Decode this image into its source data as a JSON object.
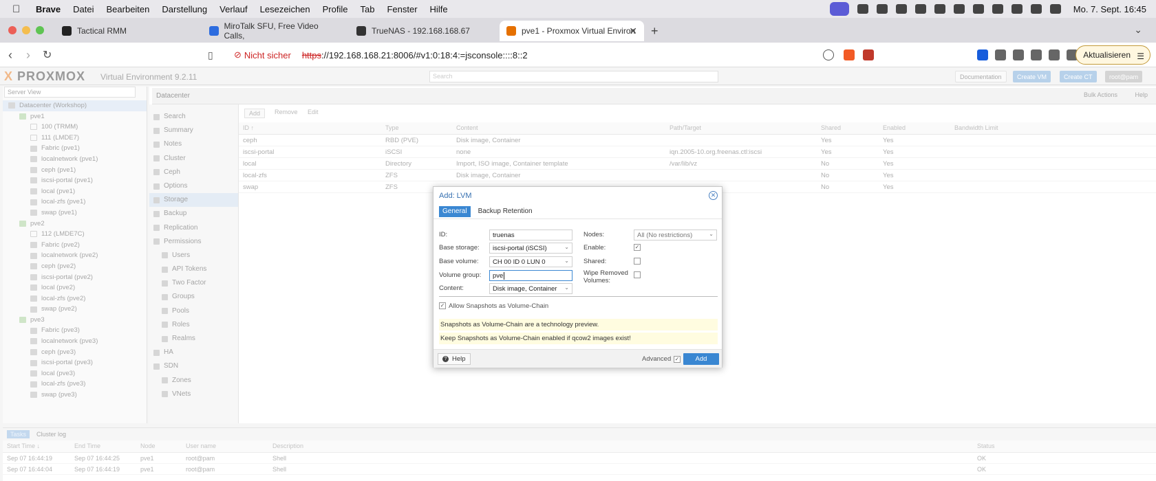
{
  "menubar": {
    "items": [
      "Brave",
      "Datei",
      "Bearbeiten",
      "Darstellung",
      "Verlauf",
      "Lesezeichen",
      "Profile",
      "Tab",
      "Fenster",
      "Hilfe"
    ],
    "clock": "Mo. 7. Sept.  16:45"
  },
  "tabs": [
    {
      "title": "Tactical RMM"
    },
    {
      "title": "MiroTalk SFU, Free Video Calls,"
    },
    {
      "title": "TrueNAS - 192.168.168.67"
    },
    {
      "title": "pve1 - Proxmox Virtual Environ"
    }
  ],
  "address": {
    "warning": "Nicht sicher",
    "scheme": "https",
    "rest": "://192.168.168.21:8006/#v1:0:18:4:=jsconsole::::8::2",
    "update_label": "Aktualisieren"
  },
  "pve": {
    "version": "Virtual Environment 9.2.11",
    "search_placeholder": "Search",
    "documentation": "Documentation",
    "create_vm": "Create VM",
    "create_ct": "Create CT",
    "user": "root@pam",
    "server_view": "Server View",
    "tree": [
      {
        "label": "Datacenter (Workshop)",
        "indent": 0,
        "kind": "dc"
      },
      {
        "label": "pve1",
        "indent": 1,
        "kind": "node"
      },
      {
        "label": "100 (TRMM)",
        "indent": 2,
        "kind": "vm"
      },
      {
        "label": "111 (LMDE7)",
        "indent": 2,
        "kind": "vm"
      },
      {
        "label": "Fabric (pve1)",
        "indent": 2,
        "kind": "x"
      },
      {
        "label": "localnetwork (pve1)",
        "indent": 2,
        "kind": "x"
      },
      {
        "label": "ceph (pve1)",
        "indent": 2,
        "kind": "x"
      },
      {
        "label": "iscsi-portal (pve1)",
        "indent": 2,
        "kind": "x"
      },
      {
        "label": "local (pve1)",
        "indent": 2,
        "kind": "x"
      },
      {
        "label": "local-zfs (pve1)",
        "indent": 2,
        "kind": "x"
      },
      {
        "label": "swap (pve1)",
        "indent": 2,
        "kind": "x"
      },
      {
        "label": "pve2",
        "indent": 1,
        "kind": "node"
      },
      {
        "label": "112 (LMDE7C)",
        "indent": 2,
        "kind": "vm"
      },
      {
        "label": "Fabric (pve2)",
        "indent": 2,
        "kind": "x"
      },
      {
        "label": "localnetwork (pve2)",
        "indent": 2,
        "kind": "x"
      },
      {
        "label": "ceph (pve2)",
        "indent": 2,
        "kind": "x"
      },
      {
        "label": "iscsi-portal (pve2)",
        "indent": 2,
        "kind": "x"
      },
      {
        "label": "local (pve2)",
        "indent": 2,
        "kind": "x"
      },
      {
        "label": "local-zfs (pve2)",
        "indent": 2,
        "kind": "x"
      },
      {
        "label": "swap (pve2)",
        "indent": 2,
        "kind": "x"
      },
      {
        "label": "pve3",
        "indent": 1,
        "kind": "node"
      },
      {
        "label": "Fabric (pve3)",
        "indent": 2,
        "kind": "x"
      },
      {
        "label": "localnetwork (pve3)",
        "indent": 2,
        "kind": "x"
      },
      {
        "label": "ceph (pve3)",
        "indent": 2,
        "kind": "x"
      },
      {
        "label": "iscsi-portal (pve3)",
        "indent": 2,
        "kind": "x"
      },
      {
        "label": "local (pve3)",
        "indent": 2,
        "kind": "x"
      },
      {
        "label": "local-zfs (pve3)",
        "indent": 2,
        "kind": "x"
      },
      {
        "label": "swap (pve3)",
        "indent": 2,
        "kind": "x"
      }
    ],
    "breadcrumb": "Datacenter",
    "bulk_actions": "Bulk Actions",
    "help": "Help",
    "menu": [
      {
        "label": "Search",
        "sub": false
      },
      {
        "label": "Summary",
        "sub": false
      },
      {
        "label": "Notes",
        "sub": false
      },
      {
        "label": "Cluster",
        "sub": false
      },
      {
        "label": "Ceph",
        "sub": false
      },
      {
        "label": "Options",
        "sub": false
      },
      {
        "label": "Storage",
        "sub": false,
        "selected": true
      },
      {
        "label": "Backup",
        "sub": false
      },
      {
        "label": "Replication",
        "sub": false
      },
      {
        "label": "Permissions",
        "sub": false
      },
      {
        "label": "Users",
        "sub": true
      },
      {
        "label": "API Tokens",
        "sub": true
      },
      {
        "label": "Two Factor",
        "sub": true
      },
      {
        "label": "Groups",
        "sub": true
      },
      {
        "label": "Pools",
        "sub": true
      },
      {
        "label": "Roles",
        "sub": true
      },
      {
        "label": "Realms",
        "sub": true
      },
      {
        "label": "HA",
        "sub": false
      },
      {
        "label": "SDN",
        "sub": false
      },
      {
        "label": "Zones",
        "sub": true
      },
      {
        "label": "VNets",
        "sub": true
      }
    ],
    "grid_toolbar": {
      "add": "Add",
      "remove": "Remove",
      "edit": "Edit"
    },
    "columns": [
      "ID ↑",
      "Type",
      "Content",
      "Path/Target",
      "Shared",
      "Enabled",
      "Bandwidth Limit"
    ],
    "rows": [
      [
        "ceph",
        "RBD (PVE)",
        "Disk image, Container",
        "",
        "Yes",
        "Yes"
      ],
      [
        "iscsi-portal",
        "iSCSI",
        "none",
        "iqn.2005-10.org.freenas.ctl:iscsi",
        "Yes",
        "Yes"
      ],
      [
        "local",
        "Directory",
        "Import, ISO image, Container template",
        "/var/lib/vz",
        "No",
        "Yes"
      ],
      [
        "local-zfs",
        "ZFS",
        "Disk image, Container",
        "",
        "No",
        "Yes"
      ],
      [
        "swap",
        "ZFS",
        "",
        "",
        "No",
        "Yes"
      ]
    ],
    "task_tabs": [
      "Tasks",
      "Cluster log"
    ],
    "task_columns": [
      "Start Time ↓",
      "End Time",
      "Node",
      "User name",
      "Description",
      "Status"
    ],
    "task_rows": [
      [
        "Sep 07 16:44:19",
        "Sep 07 16:44:25",
        "pve1",
        "root@pam",
        "Shell",
        "OK"
      ],
      [
        "Sep 07 16:44:04",
        "Sep 07 16:44:19",
        "pve1",
        "root@pam",
        "Shell",
        "OK"
      ]
    ]
  },
  "dialog": {
    "title": "Add: LVM",
    "tabs": [
      "General",
      "Backup Retention"
    ],
    "id_label": "ID:",
    "id_value": "truenas",
    "base_storage_label": "Base storage:",
    "base_storage_value": "iscsi-portal (iSCSI)",
    "base_volume_label": "Base volume:",
    "base_volume_value": "CH 00 ID 0 LUN 0",
    "vg_label": "Volume group:",
    "vg_value": "pve",
    "content_label": "Content:",
    "content_value": "Disk image, Container",
    "nodes_label": "Nodes:",
    "nodes_value": "All (No restrictions)",
    "enable_label": "Enable:",
    "shared_label": "Shared:",
    "wipe_label_1": "Wipe Removed",
    "wipe_label_2": "Volumes:",
    "snap_label": "Allow Snapshots as Volume-Chain",
    "notice1": "Snapshots as Volume-Chain are a technology preview.",
    "notice2": "Keep Snapshots as Volume-Chain enabled if qcow2 images exist!",
    "help": "Help",
    "advanced": "Advanced",
    "add": "Add"
  }
}
